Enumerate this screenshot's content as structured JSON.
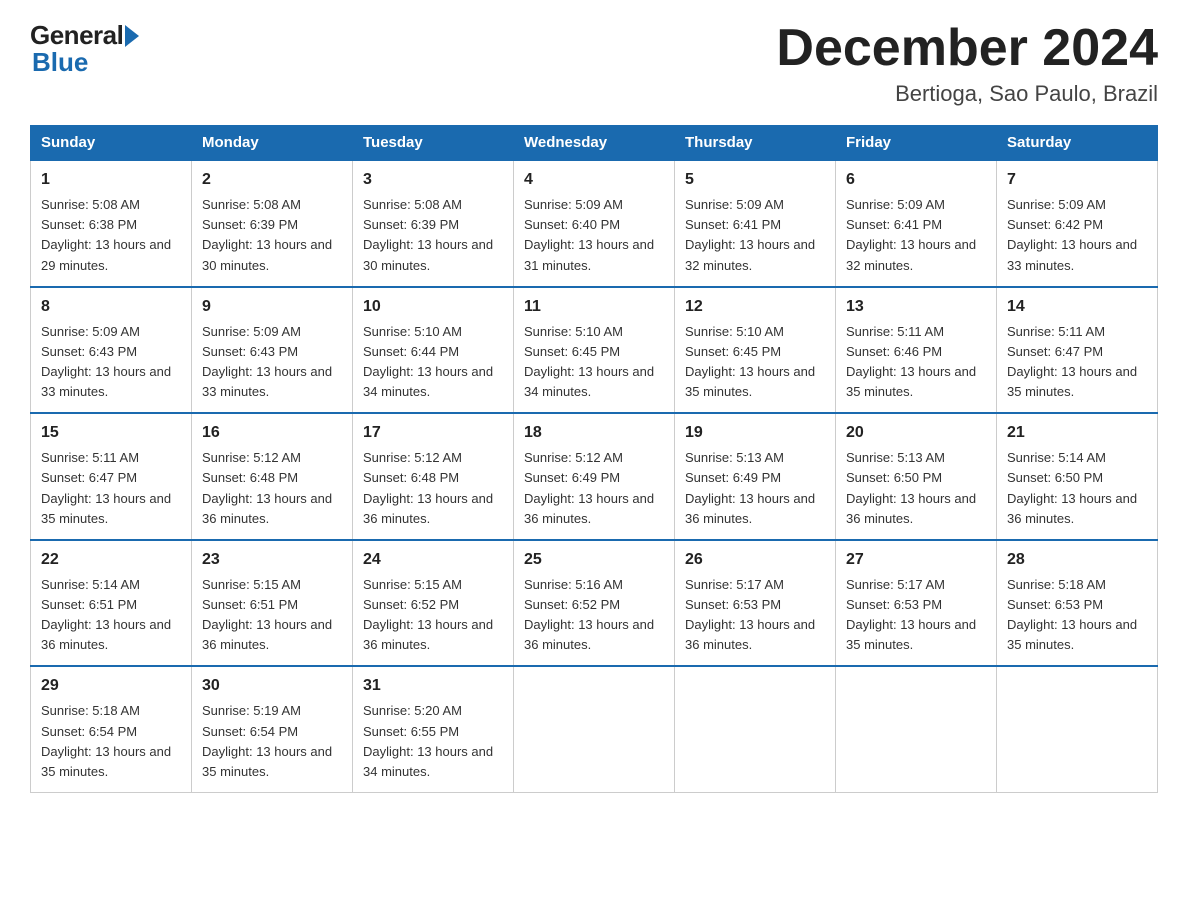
{
  "header": {
    "logo_text_general": "General",
    "logo_text_blue": "Blue",
    "month_year": "December 2024",
    "location": "Bertioga, Sao Paulo, Brazil"
  },
  "days_of_week": [
    "Sunday",
    "Monday",
    "Tuesday",
    "Wednesday",
    "Thursday",
    "Friday",
    "Saturday"
  ],
  "weeks": [
    [
      {
        "day": "1",
        "sunrise": "5:08 AM",
        "sunset": "6:38 PM",
        "daylight": "13 hours and 29 minutes."
      },
      {
        "day": "2",
        "sunrise": "5:08 AM",
        "sunset": "6:39 PM",
        "daylight": "13 hours and 30 minutes."
      },
      {
        "day": "3",
        "sunrise": "5:08 AM",
        "sunset": "6:39 PM",
        "daylight": "13 hours and 30 minutes."
      },
      {
        "day": "4",
        "sunrise": "5:09 AM",
        "sunset": "6:40 PM",
        "daylight": "13 hours and 31 minutes."
      },
      {
        "day": "5",
        "sunrise": "5:09 AM",
        "sunset": "6:41 PM",
        "daylight": "13 hours and 32 minutes."
      },
      {
        "day": "6",
        "sunrise": "5:09 AM",
        "sunset": "6:41 PM",
        "daylight": "13 hours and 32 minutes."
      },
      {
        "day": "7",
        "sunrise": "5:09 AM",
        "sunset": "6:42 PM",
        "daylight": "13 hours and 33 minutes."
      }
    ],
    [
      {
        "day": "8",
        "sunrise": "5:09 AM",
        "sunset": "6:43 PM",
        "daylight": "13 hours and 33 minutes."
      },
      {
        "day": "9",
        "sunrise": "5:09 AM",
        "sunset": "6:43 PM",
        "daylight": "13 hours and 33 minutes."
      },
      {
        "day": "10",
        "sunrise": "5:10 AM",
        "sunset": "6:44 PM",
        "daylight": "13 hours and 34 minutes."
      },
      {
        "day": "11",
        "sunrise": "5:10 AM",
        "sunset": "6:45 PM",
        "daylight": "13 hours and 34 minutes."
      },
      {
        "day": "12",
        "sunrise": "5:10 AM",
        "sunset": "6:45 PM",
        "daylight": "13 hours and 35 minutes."
      },
      {
        "day": "13",
        "sunrise": "5:11 AM",
        "sunset": "6:46 PM",
        "daylight": "13 hours and 35 minutes."
      },
      {
        "day": "14",
        "sunrise": "5:11 AM",
        "sunset": "6:47 PM",
        "daylight": "13 hours and 35 minutes."
      }
    ],
    [
      {
        "day": "15",
        "sunrise": "5:11 AM",
        "sunset": "6:47 PM",
        "daylight": "13 hours and 35 minutes."
      },
      {
        "day": "16",
        "sunrise": "5:12 AM",
        "sunset": "6:48 PM",
        "daylight": "13 hours and 36 minutes."
      },
      {
        "day": "17",
        "sunrise": "5:12 AM",
        "sunset": "6:48 PM",
        "daylight": "13 hours and 36 minutes."
      },
      {
        "day": "18",
        "sunrise": "5:12 AM",
        "sunset": "6:49 PM",
        "daylight": "13 hours and 36 minutes."
      },
      {
        "day": "19",
        "sunrise": "5:13 AM",
        "sunset": "6:49 PM",
        "daylight": "13 hours and 36 minutes."
      },
      {
        "day": "20",
        "sunrise": "5:13 AM",
        "sunset": "6:50 PM",
        "daylight": "13 hours and 36 minutes."
      },
      {
        "day": "21",
        "sunrise": "5:14 AM",
        "sunset": "6:50 PM",
        "daylight": "13 hours and 36 minutes."
      }
    ],
    [
      {
        "day": "22",
        "sunrise": "5:14 AM",
        "sunset": "6:51 PM",
        "daylight": "13 hours and 36 minutes."
      },
      {
        "day": "23",
        "sunrise": "5:15 AM",
        "sunset": "6:51 PM",
        "daylight": "13 hours and 36 minutes."
      },
      {
        "day": "24",
        "sunrise": "5:15 AM",
        "sunset": "6:52 PM",
        "daylight": "13 hours and 36 minutes."
      },
      {
        "day": "25",
        "sunrise": "5:16 AM",
        "sunset": "6:52 PM",
        "daylight": "13 hours and 36 minutes."
      },
      {
        "day": "26",
        "sunrise": "5:17 AM",
        "sunset": "6:53 PM",
        "daylight": "13 hours and 36 minutes."
      },
      {
        "day": "27",
        "sunrise": "5:17 AM",
        "sunset": "6:53 PM",
        "daylight": "13 hours and 35 minutes."
      },
      {
        "day": "28",
        "sunrise": "5:18 AM",
        "sunset": "6:53 PM",
        "daylight": "13 hours and 35 minutes."
      }
    ],
    [
      {
        "day": "29",
        "sunrise": "5:18 AM",
        "sunset": "6:54 PM",
        "daylight": "13 hours and 35 minutes."
      },
      {
        "day": "30",
        "sunrise": "5:19 AM",
        "sunset": "6:54 PM",
        "daylight": "13 hours and 35 minutes."
      },
      {
        "day": "31",
        "sunrise": "5:20 AM",
        "sunset": "6:55 PM",
        "daylight": "13 hours and 34 minutes."
      },
      null,
      null,
      null,
      null
    ]
  ],
  "labels": {
    "sunrise_prefix": "Sunrise: ",
    "sunset_prefix": "Sunset: ",
    "daylight_prefix": "Daylight: "
  }
}
